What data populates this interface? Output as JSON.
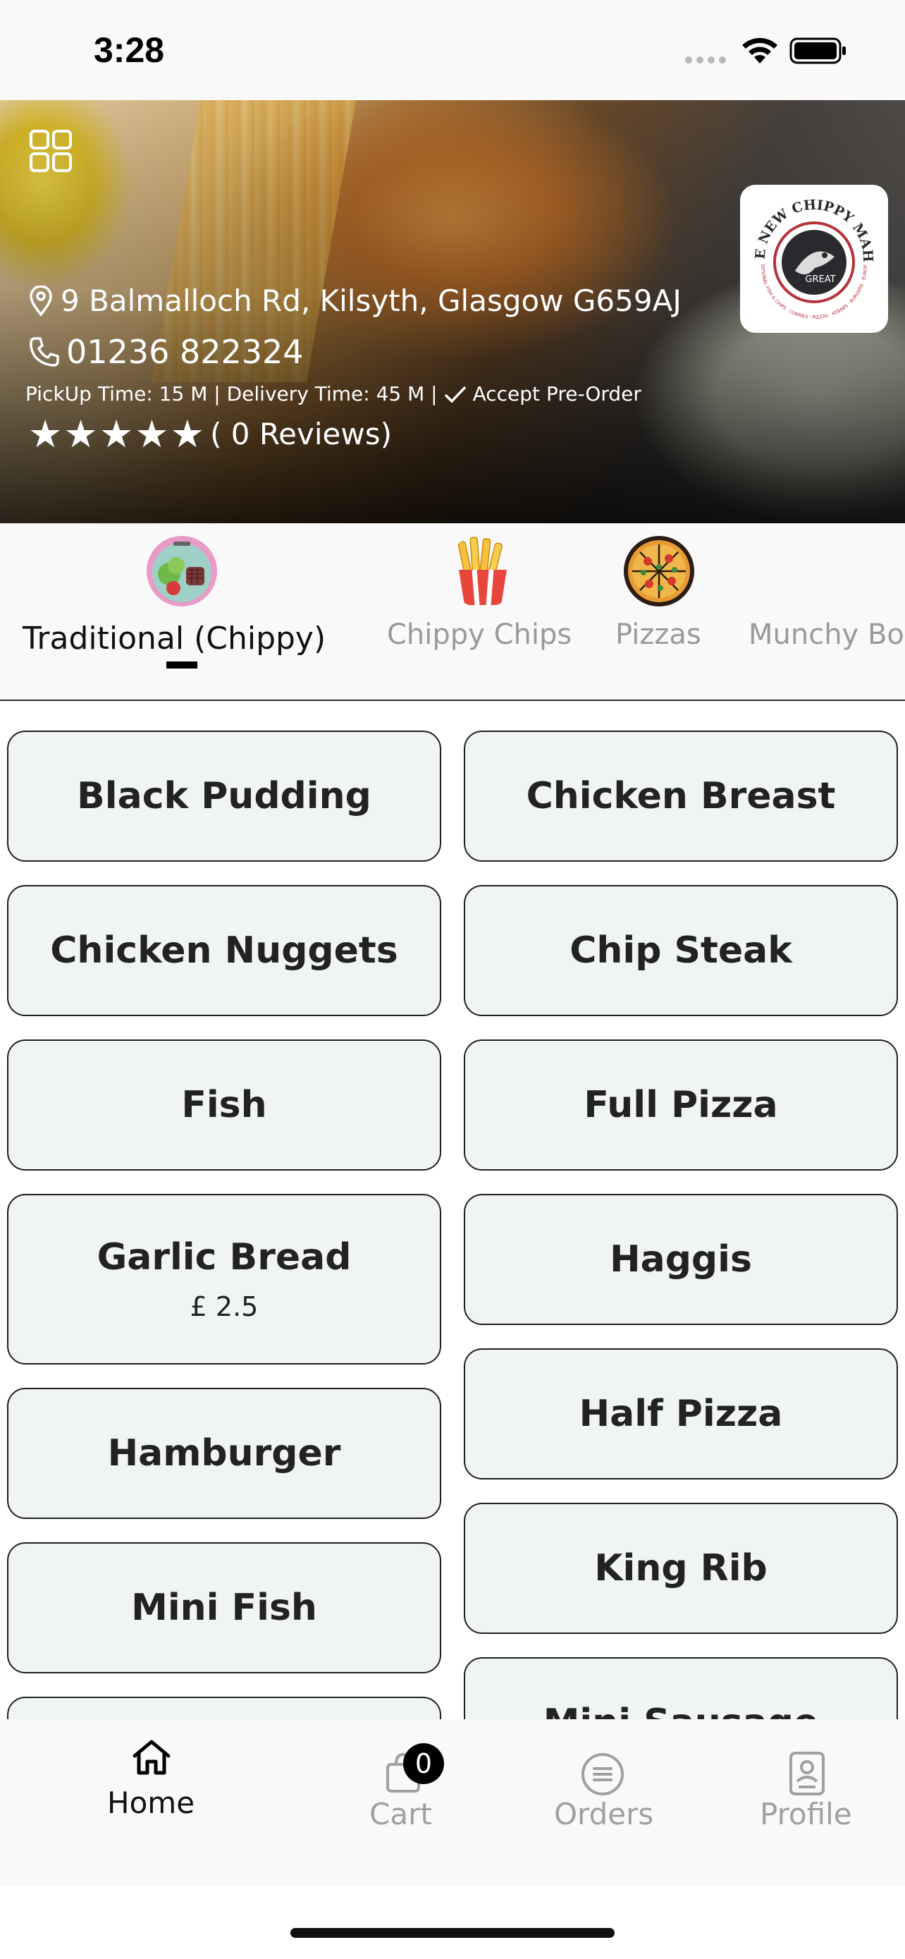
{
  "status_bar": {
    "time": "3:28"
  },
  "hero": {
    "address": "9 Balmalloch Rd, Kilsyth, Glasgow G659AJ",
    "phone": "01236 822324",
    "pickup": "PickUp Time: 15 M | Delivery Time: 45 M |",
    "pre_order": "Accept Pre-Order",
    "stars": "★★★★★",
    "reviews": "( 0 Reviews)",
    "logo": {
      "top_text": "THE NEW CHIPPY MAHAL",
      "center_text": "GREAT",
      "ring_text": "TRADITIONAL FISH & CHIPS · CURRIES · PIZZAS · KEBABS · BURGERS · EUROPEAN"
    }
  },
  "categories": [
    {
      "label": "Traditional (Chippy)",
      "active": true,
      "icon": "salad-plate-icon"
    },
    {
      "label": "Chippy Chips",
      "active": false,
      "icon": "fries-icon"
    },
    {
      "label": "Pizzas",
      "active": false,
      "icon": "pizza-icon"
    },
    {
      "label": "Munchy Bo",
      "active": false,
      "icon": ""
    }
  ],
  "items_left": [
    {
      "name": "Black Pudding"
    },
    {
      "name": "Chicken Nuggets"
    },
    {
      "name": "Fish"
    },
    {
      "name": "Garlic Bread",
      "price": "£ 2.5"
    },
    {
      "name": "Hamburger"
    },
    {
      "name": "Mini Fish"
    },
    {
      "name": ""
    }
  ],
  "items_right": [
    {
      "name": "Chicken Breast"
    },
    {
      "name": "Chip Steak"
    },
    {
      "name": "Full Pizza"
    },
    {
      "name": "Haggis"
    },
    {
      "name": "Half Pizza"
    },
    {
      "name": "King Rib"
    },
    {
      "name": "Mini Sausage"
    }
  ],
  "bottom_nav": {
    "home": "Home",
    "cart": "Cart",
    "cart_count": "0",
    "orders": "Orders",
    "profile": "Profile"
  },
  "colors": {
    "card_bg": "#f1f4f4",
    "card_border": "#1f1f1f",
    "active_text": "#111111",
    "inactive_text": "#9a9a9a"
  }
}
